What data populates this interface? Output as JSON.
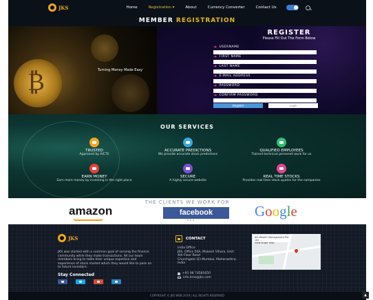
{
  "nav": {
    "logo": "JKS",
    "items": [
      "Home",
      "Registration ▾",
      "About",
      "Currency Converter",
      "Contact Us"
    ]
  },
  "registration": {
    "title_white": "MEMBER",
    "title_yellow": "REGISTRATION",
    "coin_caption": "Turning Money Made Easy",
    "form_heading": "REGISTER",
    "form_sub": "Please Fill Out The Form Below",
    "fields": [
      "USERNAME",
      "FIRST NAME",
      "LAST NAME",
      "E-MAIL ADDRESS",
      "PASSWORD",
      "CONFIRM PASSWORD"
    ],
    "register_label": "Register",
    "login_label": "Login"
  },
  "services": {
    "title": "OUR SERVICES",
    "items": [
      {
        "title": "TRUSTED",
        "desc": "Approved by AICTE",
        "color": "#f6a623",
        "icon": "thumbs-up-icon"
      },
      {
        "title": "ACCURATE PREDICTIONS",
        "desc": "We provide accurate stock predictions",
        "color": "#3aa8e0",
        "icon": "chart-icon"
      },
      {
        "title": "QUALIFIED EMPLOYEES",
        "desc": "Trained technical personell work for us",
        "color": "#2fbf71",
        "icon": "id-card-icon"
      },
      {
        "title": "EARN MONEY",
        "desc": "Earn more money by investing in the right place",
        "color": "#e8413c",
        "icon": "money-icon"
      },
      {
        "title": "SECURE",
        "desc": "A highly secure website",
        "color": "#7b4fd6",
        "icon": "shield-icon"
      },
      {
        "title": "REAL TIME STOCKS",
        "desc": "Provides real time stock quotes for the companies",
        "color": "#e84393",
        "icon": "clock-icon"
      }
    ]
  },
  "clients": {
    "title": "THE CLIENTS WE WORK FOR",
    "amazon": "amazon",
    "facebook": "facebook",
    "google": [
      "G",
      "o",
      "o",
      "g",
      "l",
      "e"
    ]
  },
  "footer": {
    "logo": "JKS",
    "about": "JKS was started with a common goal of serving the finance community while they make transactions. All our team members bring to table their unique expertise and experience of stock market which they would like to pass on to future investors.",
    "stay_connected": "Stay Connected",
    "socials": [
      {
        "name": "facebook",
        "color": "#3b5998"
      },
      {
        "name": "twitter",
        "color": "#1da1f2"
      },
      {
        "name": "google-plus",
        "color": "#dd4b39"
      },
      {
        "name": "mail",
        "color": "#2a86c9"
      }
    ],
    "contact_head": "CONTACT",
    "address": "India Office\nJKS, Office 50A, Mukesh Vihara, Unit: 4th Floor Road\nChurchgate (E) Mumbai, Maharashtra, India",
    "phone": "+91 98 74581650",
    "email": "info.kms@jks.com",
    "map_card": "JKS Wealth Management Pvt Ltd\nView larger map"
  },
  "copyright": "COPYRIGHT © JKS WEB 2019 | ALL RIGHTS RESERVED"
}
